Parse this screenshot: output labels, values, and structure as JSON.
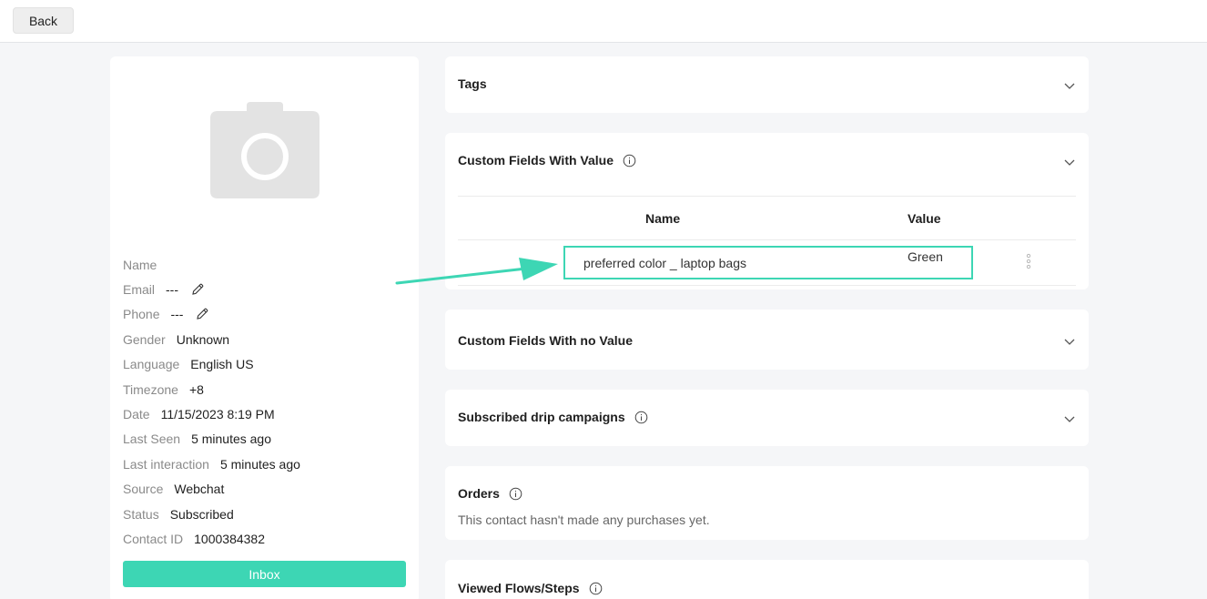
{
  "topbar": {
    "back_label": "Back"
  },
  "profile": {
    "fields": [
      {
        "label": "Name",
        "value": "",
        "editable": false
      },
      {
        "label": "Email",
        "value": "---",
        "editable": true
      },
      {
        "label": "Phone",
        "value": "---",
        "editable": true
      },
      {
        "label": "Gender",
        "value": "Unknown",
        "editable": false
      },
      {
        "label": "Language",
        "value": "English US",
        "editable": false
      },
      {
        "label": "Timezone",
        "value": "+8",
        "editable": false
      },
      {
        "label": "Date",
        "value": "11/15/2023 8:19 PM",
        "editable": false
      },
      {
        "label": "Last Seen",
        "value": "5 minutes ago",
        "editable": false
      },
      {
        "label": "Last interaction",
        "value": "5 minutes ago",
        "editable": false
      },
      {
        "label": "Source",
        "value": "Webchat",
        "editable": false
      },
      {
        "label": "Status",
        "value": "Subscribed",
        "editable": false
      },
      {
        "label": "Contact ID",
        "value": "1000384382",
        "editable": false
      }
    ],
    "inbox_label": "Inbox"
  },
  "sections": {
    "tags": {
      "title": "Tags"
    },
    "custom_with_value": {
      "title": "Custom Fields With Value",
      "col_name": "Name",
      "col_value": "Value",
      "rows": [
        {
          "name": "preferred color _ laptop bags",
          "value": "Green"
        }
      ]
    },
    "custom_no_value": {
      "title": "Custom Fields With no Value"
    },
    "drip": {
      "title": "Subscribed drip campaigns"
    },
    "orders": {
      "title": "Orders",
      "note": "This contact hasn't made any purchases yet."
    },
    "viewed_flows": {
      "title": "Viewed Flows/Steps"
    }
  },
  "colors": {
    "accent": "#3dd6b4",
    "label_gray": "#8a8a8a",
    "background": "#f5f6f8"
  }
}
